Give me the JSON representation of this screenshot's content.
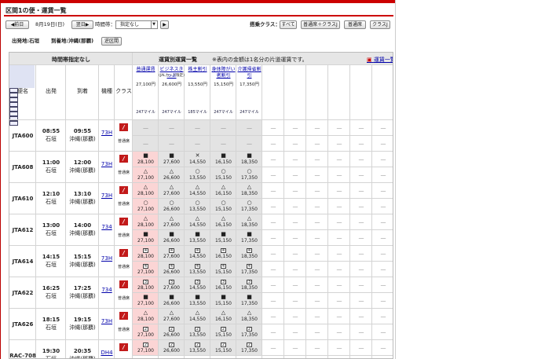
{
  "page": {
    "title": "区間1の便・運賃一覧"
  },
  "nav": {
    "prev_day": "◀前日",
    "date": "8月19日(日)",
    "next_day": "翌日▶",
    "time_label": "時間帯：",
    "time_select": "指定なし",
    "time_go": "▶",
    "class_label": "搭乗クラス：",
    "class_buttons": [
      "すべて",
      "普通席＋クラスJ",
      "普通席",
      "クラスJ"
    ]
  },
  "route": {
    "departure": "出発地:石垣",
    "arrival": "到着地:沖縄(那覇)",
    "reverse": "逆区間"
  },
  "header": {
    "time_unspecified": "時間帯指定なし",
    "fare_title": "運賃別運賃一覧",
    "fare_note": "※表内の金額は1名分の片道運賃です。",
    "fare_list_link": "運賃一覧",
    "cols": [
      "便名",
      "出発",
      "到着",
      "機種",
      "クラス"
    ]
  },
  "fares": [
    {
      "name": "普通運賃",
      "price": "27,100円",
      "miles": "247マイル"
    },
    {
      "name": "ビジネスきっぷ",
      "sub": "(JALカード限定)",
      "price": "26,600円",
      "miles": "247マイル"
    },
    {
      "name": "株主割引",
      "price": "13,550円",
      "miles": "185マイル"
    },
    {
      "name": "身体障がい者割引",
      "price": "15,150円",
      "miles": "247マイル"
    },
    {
      "name": "介護帰省割引",
      "price": "17,350円",
      "miles": "247マイル"
    }
  ],
  "flights": [
    {
      "no": "JTA600",
      "dep": "08:55",
      "dep_place": "石垣",
      "arr": "09:55",
      "arr_place": "沖縄(那覇)",
      "type": "73H",
      "class": "普通席",
      "rows": [
        [
          "—",
          "—",
          "—",
          "—",
          "—"
        ],
        [
          "—",
          "—",
          "—",
          "—",
          "—"
        ]
      ]
    },
    {
      "no": "JTA608",
      "dep": "11:00",
      "dep_place": "石垣",
      "arr": "12:00",
      "arr_place": "沖縄(那覇)",
      "type": "73H",
      "class": "普通席",
      "rows": [
        [
          "■ 28,100",
          "■ 27,600",
          "✕ 14,550",
          "■ 16,150",
          "■ 18,350"
        ],
        [
          "△ 27,100",
          "△ 26,600",
          "○ 13,550",
          "○ 15,150",
          "○ 17,350"
        ]
      ]
    },
    {
      "no": "JTA610",
      "dep": "12:10",
      "dep_place": "石垣",
      "arr": "13:10",
      "arr_place": "沖縄(那覇)",
      "type": "73H",
      "class": "普通席",
      "rows": [
        [
          "△ 28,100",
          "△ 27,600",
          "△ 14,550",
          "△ 16,150",
          "△ 18,350"
        ],
        [
          "○ 27,100",
          "○ 26,600",
          "○ 13,550",
          "○ 15,150",
          "○ 17,350"
        ]
      ]
    },
    {
      "no": "JTA612",
      "dep": "13:00",
      "dep_place": "石垣",
      "arr": "14:00",
      "arr_place": "沖縄(那覇)",
      "type": "734",
      "class": "普通席",
      "rows": [
        [
          "△ 28,100",
          "△ 27,600",
          "△ 14,550",
          "△ 16,150",
          "△ 18,350"
        ],
        [
          "■ 27,100",
          "■ 26,600",
          "■ 13,550",
          "■ 15,150",
          "■ 17,350"
        ]
      ]
    },
    {
      "no": "JTA614",
      "dep": "14:15",
      "dep_place": "石垣",
      "arr": "15:15",
      "arr_place": "沖縄(那覇)",
      "type": "73H",
      "class": "普通席",
      "rows": [
        [
          "4 28,100",
          "4 27,600",
          "4 14,550",
          "4 16,150",
          "4 18,350"
        ],
        [
          "4 27,100",
          "4 26,600",
          "4 13,550",
          "4 15,150",
          "4 17,350"
        ]
      ]
    },
    {
      "no": "JTA622",
      "dep": "16:25",
      "dep_place": "石垣",
      "arr": "17:25",
      "arr_place": "沖縄(那覇)",
      "type": "734",
      "class": "普通席",
      "rows": [
        [
          "3 28,100",
          "3 27,600",
          "3 14,550",
          "3 16,150",
          "3 18,350"
        ],
        [
          "■ 27,100",
          "■ 26,600",
          "■ 13,550",
          "■ 15,150",
          "■ 17,350"
        ]
      ]
    },
    {
      "no": "JTA626",
      "dep": "18:15",
      "dep_place": "石垣",
      "arr": "19:15",
      "arr_place": "沖縄(那覇)",
      "type": "73H",
      "class": "普通席",
      "rows": [
        [
          "△ 28,100",
          "△ 27,600",
          "△ 14,550",
          "△ 16,150",
          "△ 18,350"
        ],
        [
          "2 27,100",
          "2 26,600",
          "2 13,550",
          "2 15,150",
          "2 17,350"
        ]
      ]
    },
    {
      "no": "RAC-708",
      "dep": "19:30",
      "dep_place": "石垣",
      "arr": "20:35",
      "arr_place": "沖縄(那覇)",
      "type": "DH4",
      "class": "普通席",
      "rows": [
        [
          "2 27,100",
          "2 26,600",
          "2 13,550",
          "2 15,150",
          "2 17,350"
        ],
        [
          "",
          "",
          "",
          "",
          ""
        ]
      ]
    }
  ],
  "colors": {
    "brand": "#cc0000",
    "pink": "#fbd5d5",
    "gray": "#e3e3e3",
    "header": "#e6e6e6"
  }
}
